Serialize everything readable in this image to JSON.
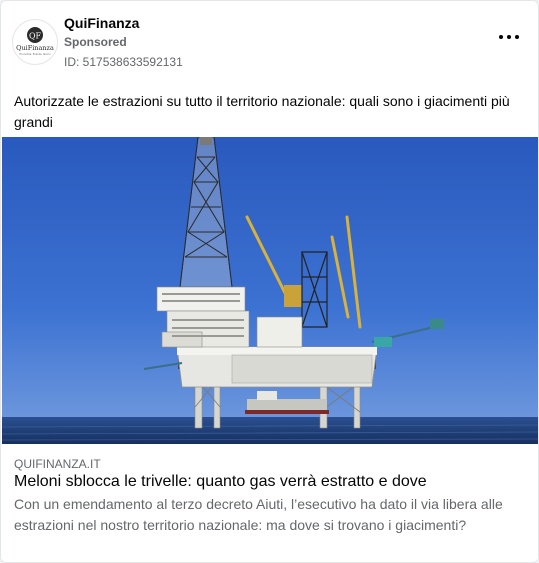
{
  "post": {
    "advertiser": "QuiFinanza",
    "sponsored_label": "Sponsored",
    "ad_id": "ID: 517538633592131",
    "caption": "Autorizzate le estrazioni su tutto il territorio nazionale: quali sono i giacimenti più grandi",
    "logo": {
      "monogram": "QF",
      "wordmark": "QuiFinanza",
      "tagline": "Economia, finanza, lavoro"
    }
  },
  "link": {
    "domain": "QUIFINANZA.IT",
    "headline": "Meloni sblocca le trivelle: quanto gas verrà estratto e dove",
    "description": "Con un emendamento al terzo decreto Aiuti, l’esecutivo ha dato il via libera alle estrazioni nel nostro territorio nazionale: ma dove si trovano i giacimenti?"
  },
  "colors": {
    "sky": "#2f63c6",
    "sea": "#1e3f7a",
    "text": "#050505",
    "muted": "#65676b"
  }
}
